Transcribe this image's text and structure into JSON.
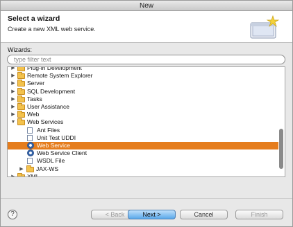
{
  "window": {
    "title": "New"
  },
  "header": {
    "title": "Select a wizard",
    "description": "Create a new XML web service."
  },
  "wizards_label": "Wizards:",
  "filter": {
    "placeholder": "type filter text",
    "value": ""
  },
  "tree": {
    "items": [
      {
        "label": "Plug-in Development",
        "icon": "folder-icon",
        "expander": "collapsed",
        "level": 0,
        "selected": false
      },
      {
        "label": "Remote System Explorer",
        "icon": "folder-icon",
        "expander": "collapsed",
        "level": 0,
        "selected": false
      },
      {
        "label": "Server",
        "icon": "folder-icon",
        "expander": "collapsed",
        "level": 0,
        "selected": false
      },
      {
        "label": "SQL Development",
        "icon": "folder-icon",
        "expander": "collapsed",
        "level": 0,
        "selected": false
      },
      {
        "label": "Tasks",
        "icon": "folder-icon",
        "expander": "collapsed",
        "level": 0,
        "selected": false
      },
      {
        "label": "User Assistance",
        "icon": "folder-icon",
        "expander": "collapsed",
        "level": 0,
        "selected": false
      },
      {
        "label": "Web",
        "icon": "folder-icon",
        "expander": "collapsed",
        "level": 0,
        "selected": false
      },
      {
        "label": "Web Services",
        "icon": "folder-icon",
        "expander": "expanded",
        "level": 0,
        "selected": false
      },
      {
        "label": "Ant Files",
        "icon": "ant-files-icon",
        "expander": "none",
        "level": 1,
        "selected": false
      },
      {
        "label": "Unit Test UDDI",
        "icon": "uddi-icon",
        "expander": "none",
        "level": 1,
        "selected": false
      },
      {
        "label": "Web Service",
        "icon": "web-service-icon",
        "expander": "none",
        "level": 1,
        "selected": true
      },
      {
        "label": "Web Service Client",
        "icon": "web-service-client-icon",
        "expander": "none",
        "level": 1,
        "selected": false
      },
      {
        "label": "WSDL File",
        "icon": "wsdl-file-icon",
        "expander": "none",
        "level": 1,
        "selected": false
      },
      {
        "label": "JAX-WS",
        "icon": "folder-icon",
        "expander": "collapsed",
        "level": 1,
        "selected": false
      },
      {
        "label": "XML",
        "icon": "folder-icon",
        "expander": "collapsed",
        "level": 0,
        "selected": false
      }
    ]
  },
  "buttons": {
    "help": "?",
    "back": "< Back",
    "next": "Next >",
    "cancel": "Cancel",
    "finish": "Finish"
  },
  "colors": {
    "selection": "#e57d1d",
    "default_button": "#5aa8ea"
  }
}
